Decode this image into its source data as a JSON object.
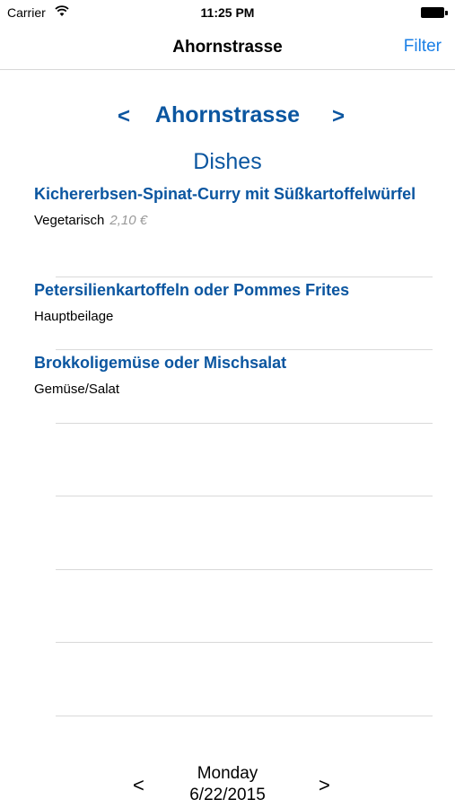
{
  "status_bar": {
    "carrier": "Carrier",
    "time": "11:25 PM"
  },
  "nav": {
    "title": "Ahornstrasse",
    "filter_label": "Filter"
  },
  "location": {
    "prev": "<",
    "name": "Ahornstrasse",
    "next": ">"
  },
  "section_heading": "Dishes",
  "dishes": [
    {
      "name": "Kichererbsen-Spinat-Curry mit Süßkartoffelwürfel",
      "category": "Vegetarisch",
      "price": "2,10 €"
    },
    {
      "name": "Petersilienkartoffeln oder Pommes Frites",
      "category": "Hauptbeilage"
    },
    {
      "name": "Brokkoligemüse oder Mischsalat",
      "category": "Gemüse/Salat"
    }
  ],
  "date_nav": {
    "prev": "<",
    "day": "Monday",
    "date": "6/22/2015",
    "next": ">"
  },
  "colors": {
    "accent": "#1a7fe6",
    "heading_blue": "#0b56a0",
    "price_gray": "#999999"
  }
}
